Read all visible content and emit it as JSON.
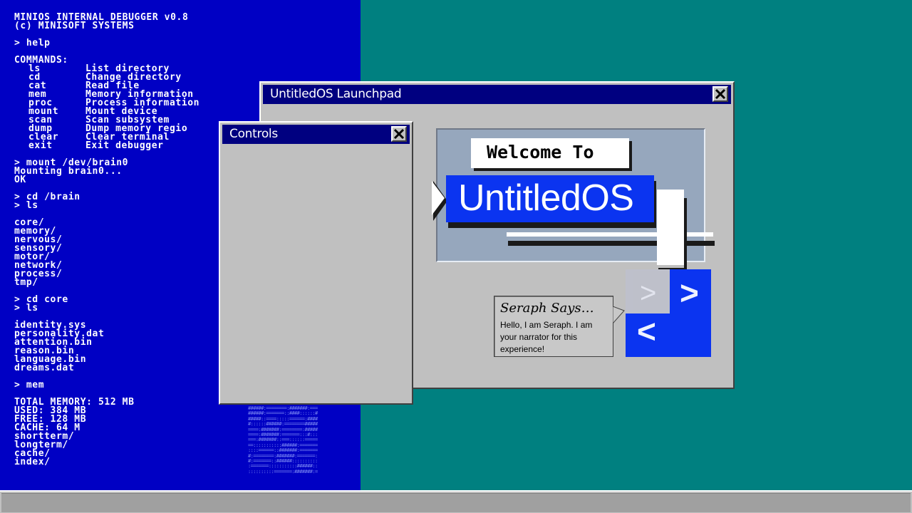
{
  "terminal": {
    "lines": [
      "MINIOS INTERNAL DEBUGGER v0.8",
      "(c) MINISOFT SYSTEMS",
      "",
      "> help",
      "",
      "COMMANDS:",
      {
        "cmd": "ls",
        "desc": "List directory"
      },
      {
        "cmd": "cd",
        "desc": "Change directory"
      },
      {
        "cmd": "cat",
        "desc": "Read file"
      },
      {
        "cmd": "mem",
        "desc": "Memory information"
      },
      {
        "cmd": "proc",
        "desc": "Process information"
      },
      {
        "cmd": "mount",
        "desc": "Mount device"
      },
      {
        "cmd": "scan",
        "desc": "Scan subsystem"
      },
      {
        "cmd": "dump",
        "desc": "Dump memory regio"
      },
      {
        "cmd": "clear",
        "desc": "Clear terminal"
      },
      {
        "cmd": "exit",
        "desc": "Exit debugger"
      },
      "",
      "> mount /dev/brain0",
      "Mounting brain0...",
      "OK",
      "",
      "> cd /brain",
      "> ls",
      "",
      "core/",
      "memory/",
      "nervous/",
      "sensory/",
      "motor/",
      "network/",
      "process/",
      "tmp/",
      "",
      "> cd core",
      "> ls",
      "",
      "identity.sys",
      "personality.dat",
      "attention.bin",
      "reason.bin",
      "language.bin",
      "dreams.dat",
      "",
      "> mem",
      "",
      "TOTAL MEMORY: 512 MB",
      "USED: 384 MB",
      "FREE: 128 MB",
      "CACHE: 64 M",
      "shortterm/",
      "longterm/",
      "cache/",
      "index/"
    ]
  },
  "launchpad": {
    "title": "UntitledOS Launchpad",
    "welcome": "Welcome To",
    "logo": "UntitledOS",
    "nav_next": ">",
    "nav_prev": "<",
    "nav_ghost": "<",
    "bubble_title": "Seraph Says…",
    "bubble_text": "Hello, I am Seraph. I am your narrator for this experience!"
  },
  "controls": {
    "title": "Controls"
  },
  "colors": {
    "desktop": "#008080",
    "terminal_bg": "#0000c4",
    "titlebar": "#000080",
    "window": "#c0c0c0",
    "logo_blue": "#0b34f0"
  }
}
